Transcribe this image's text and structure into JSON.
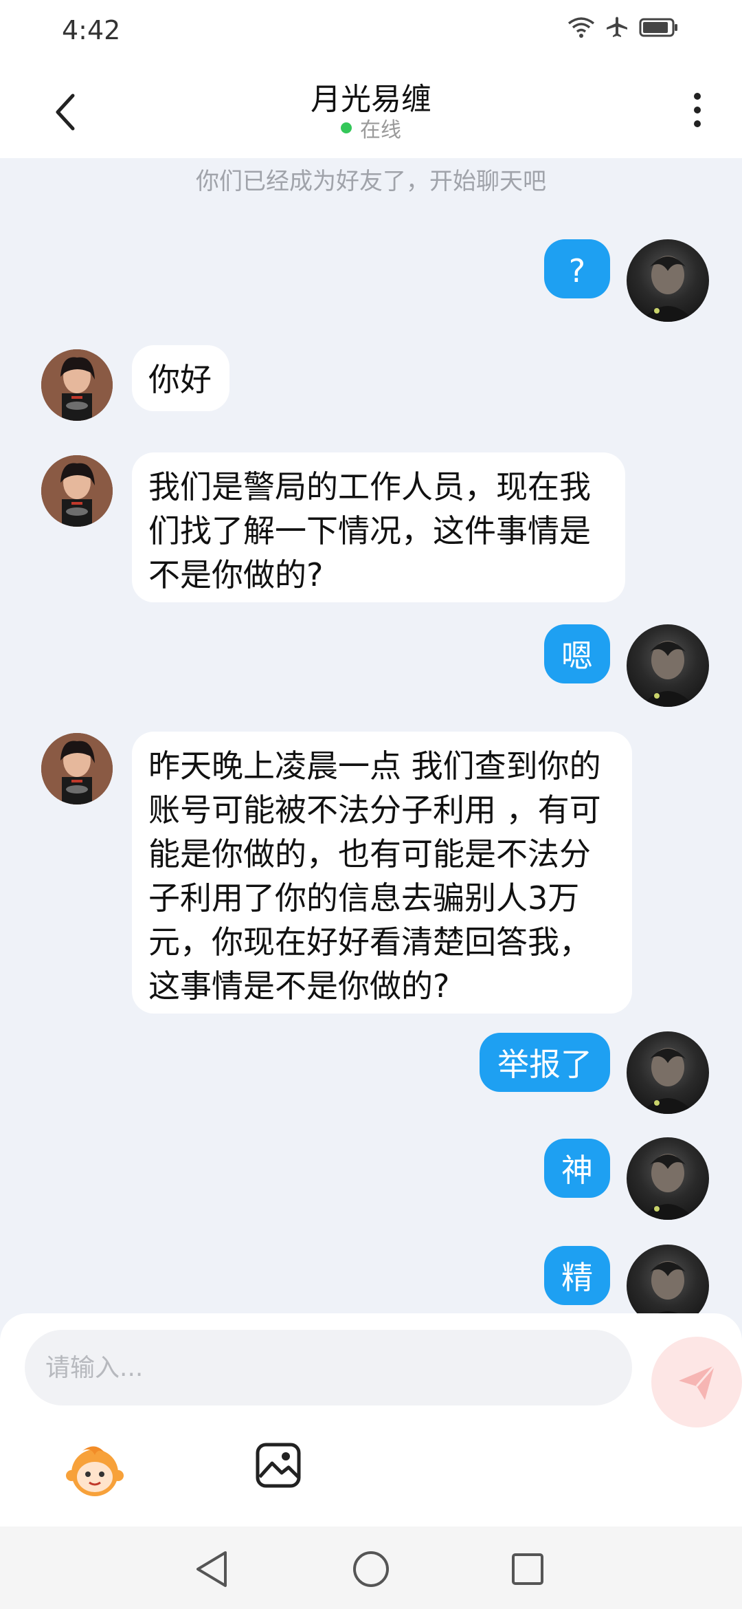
{
  "status_bar": {
    "time": "4:42",
    "icons": [
      "wifi-icon",
      "airplane-icon",
      "battery-icon"
    ]
  },
  "header": {
    "title": "月光易缠",
    "presence": "在线",
    "presence_color": "#34c759"
  },
  "system_note": "你们已经成为好友了，开始聊天吧",
  "messages": [
    {
      "from": "me",
      "text": "?"
    },
    {
      "from": "other",
      "text": "你好"
    },
    {
      "from": "other",
      "text": "我们是警局的工作人员，现在我们找了解一下情况，这件事情是不是你做的?"
    },
    {
      "from": "me",
      "text": "嗯"
    },
    {
      "from": "other",
      "text": "昨天晚上凌晨一点 我们查到你的账号可能被不法分子利用 ，有可能是你做的，也有可能是不法分子利用了你的信息去骗别人3万元，你现在好好看清楚回答我，这事情是不是你做的?"
    },
    {
      "from": "me",
      "text": "举报了"
    },
    {
      "from": "me",
      "text": "神"
    },
    {
      "from": "me",
      "text": "精"
    }
  ],
  "composer": {
    "placeholder": "请输入...",
    "value": "",
    "tools": [
      "emoji-icon",
      "image-icon"
    ],
    "send_icon": "send-icon"
  },
  "nav_bar": [
    "back-triangle-icon",
    "home-circle-icon",
    "recents-square-icon"
  ],
  "colors": {
    "my_bubble": "#1ea0f2",
    "other_bubble": "#ffffff",
    "chat_background": "#eff2f8",
    "send_button": "#fde6e5"
  }
}
